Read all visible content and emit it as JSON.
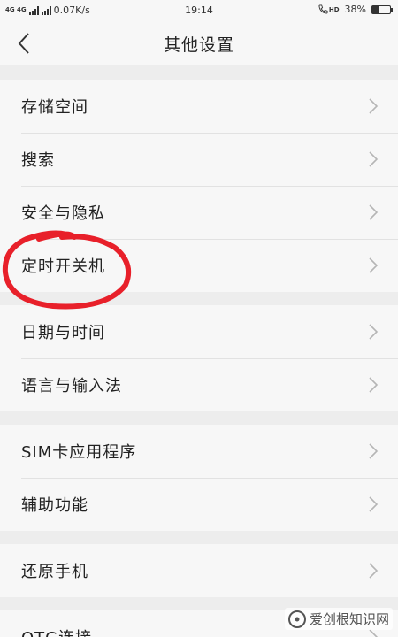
{
  "status_bar": {
    "network_label": "4G 4G",
    "speed": "0.07K/s",
    "time": "19:14",
    "hd_label": "HD",
    "battery": "38%",
    "battery_level": 0.38
  },
  "header": {
    "title": "其他设置",
    "back_icon": "chevron-left-icon"
  },
  "settings_groups": [
    {
      "items": [
        {
          "label": "存储空间"
        },
        {
          "label": "搜索"
        },
        {
          "label": "安全与隐私"
        },
        {
          "label": "定时开关机"
        }
      ]
    },
    {
      "items": [
        {
          "label": "日期与时间"
        },
        {
          "label": "语言与输入法"
        }
      ]
    },
    {
      "items": [
        {
          "label": "SIM卡应用程序"
        },
        {
          "label": "辅助功能"
        }
      ]
    },
    {
      "items": [
        {
          "label": "还原手机"
        },
        {
          "label": "OTG连接"
        }
      ]
    }
  ],
  "annotation_color": "#e8202a",
  "watermark": {
    "text": "爱创根知识网"
  }
}
